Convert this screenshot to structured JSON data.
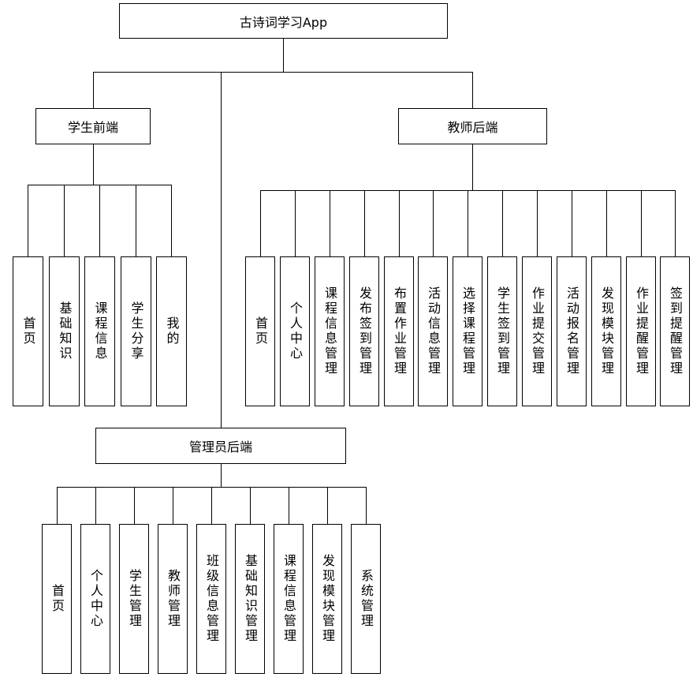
{
  "root": {
    "label": "古诗词学习App"
  },
  "student": {
    "label": "学生前端",
    "items": [
      "首页",
      "基础知识",
      "课程信息",
      "学生分享",
      "我的"
    ]
  },
  "teacher": {
    "label": "教师后端",
    "items": [
      "首页",
      "个人中心",
      "课程信息管理",
      "发布签到管理",
      "布置作业管理",
      "活动信息管理",
      "选择课程管理",
      "学生签到管理",
      "作业提交管理",
      "活动报名管理",
      "发现模块管理",
      "作业提醒管理",
      "签到提醒管理"
    ]
  },
  "admin": {
    "label": "管理员后端",
    "items": [
      "首页",
      "个人中心",
      "学生管理",
      "教师管理",
      "班级信息管理",
      "基础知识管理",
      "课程信息管理",
      "发现模块管理",
      "系统管理"
    ]
  }
}
